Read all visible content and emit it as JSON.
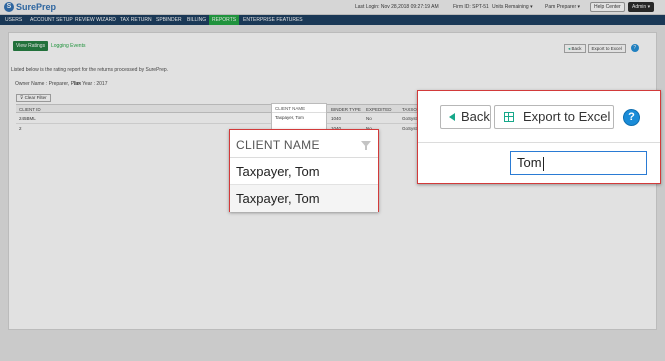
{
  "app": {
    "logo_text": "SurePrep"
  },
  "topbar": {
    "last_login": "Last Login: Nov 28,2018 09:27:19 AM",
    "firm_id": "Firm ID: SPT-51",
    "units_remaining": "Units Remaining",
    "user_select": "Pam Preparer",
    "help_center": "Help Center",
    "admin": "Admin"
  },
  "nav": {
    "items": [
      "USERS",
      "ACCOUNT SETUP",
      "REVIEW WIZARD",
      "TAX RETURN",
      "SPBINDER",
      "BILLING",
      "REPORTS",
      "ENTERPRISE FEATURES"
    ],
    "active": "REPORTS"
  },
  "tabs": {
    "view_ratings": "View Ratings",
    "logging_events": "Logging Events"
  },
  "report": {
    "intro": "Listed below is the rating report for the returns processed by SurePrep.",
    "owner": "Owner Name : Preparer, Pam",
    "tax_year": "Tax Year : 2017"
  },
  "toolbar": {
    "back": "Back",
    "export": "Export to Excel",
    "help": "?"
  },
  "grid": {
    "clear_filter": "Clear Filter",
    "columns": [
      "CLIENT ID",
      "BINDER TYPE",
      "EXPEDITED",
      "TAXSOF"
    ],
    "rows": [
      {
        "client_id": "245BML",
        "client_name": "Taxpayer, Tom",
        "binder_type": "1040",
        "expedited": "No",
        "taxsoft": "GoSyste"
      },
      {
        "client_id": "2",
        "client_name": "",
        "binder_type": "1040",
        "expedited": "No",
        "taxsoft": "GoSyste"
      }
    ]
  },
  "client_filter": {
    "header": "CLIENT NAME",
    "options": [
      "Taxpayer, Tom",
      "Taxpayer, Tom"
    ],
    "search_value": "Tom"
  },
  "colors": {
    "nav_bg": "#12365a",
    "active_green": "#1aa33c",
    "help_blue": "#1a8cd8",
    "highlight_red": "#d23a3a"
  }
}
